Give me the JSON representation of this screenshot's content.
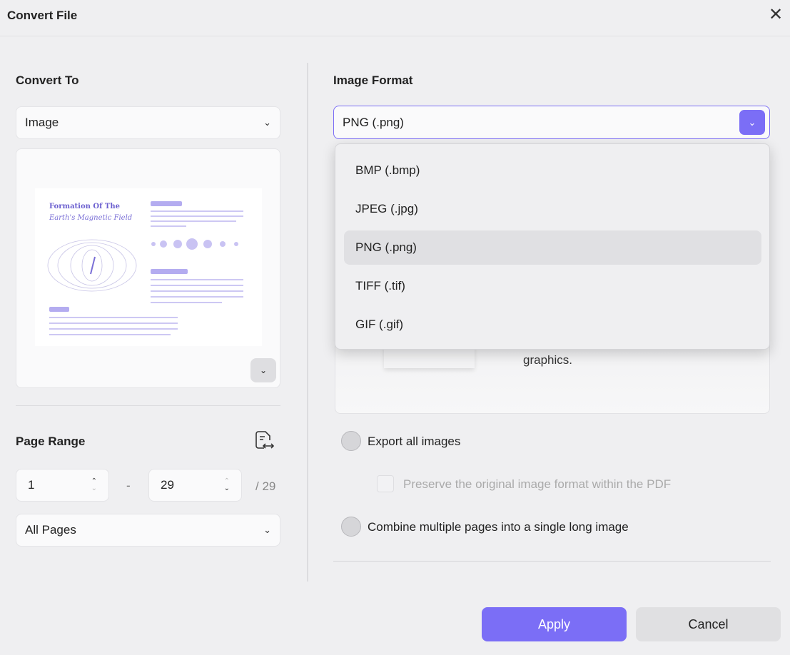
{
  "dialog": {
    "title": "Convert File"
  },
  "convert_to": {
    "heading": "Convert To",
    "value": "Image"
  },
  "preview": {
    "doc_title_line1": "Formation Of The",
    "doc_title_line2": "Earth's Magnetic Field"
  },
  "page_range": {
    "heading": "Page Range",
    "from": "1",
    "separator": "-",
    "to": "29",
    "total": "/ 29",
    "range_select": "All Pages"
  },
  "image_format": {
    "heading": "Image Format",
    "value": "PNG (.png)",
    "options": [
      "BMP (.bmp)",
      "JPEG (.jpg)",
      "PNG (.png)",
      "TIFF (.tif)",
      "GIF (.gif)"
    ],
    "selected_index": 2,
    "description_tail": "graphics."
  },
  "options": {
    "export_all": "Export all images",
    "preserve": "Preserve the original image format within the PDF",
    "combine": "Combine multiple pages into a single long image"
  },
  "buttons": {
    "apply": "Apply",
    "cancel": "Cancel"
  },
  "colors": {
    "accent": "#7b6ef6",
    "background": "#efeff1"
  }
}
